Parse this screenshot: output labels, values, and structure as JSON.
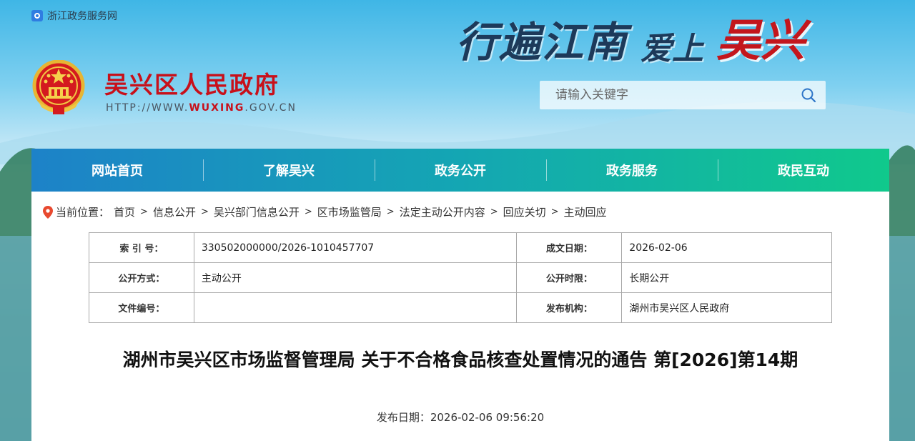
{
  "topbar": {
    "link": "浙江政务服务网"
  },
  "slogan": {
    "main": "行遍江南",
    "love": "爱上",
    "wuxing": "吴兴"
  },
  "site": {
    "title": "吴兴区人民政府",
    "url_prefix": "HTTP://WWW.",
    "url_highlight": "WUXING",
    "url_suffix": ".GOV.CN"
  },
  "search": {
    "placeholder": "请输入关键字"
  },
  "nav": [
    "网站首页",
    "了解吴兴",
    "政务公开",
    "政务服务",
    "政民互动"
  ],
  "breadcrumb": {
    "label": "当前位置：",
    "items": [
      "首页",
      "信息公开",
      "吴兴部门信息公开",
      "区市场监管局",
      "法定主动公开内容",
      "回应关切",
      "主动回应"
    ],
    "separator": ">"
  },
  "meta": {
    "rows": [
      {
        "k1": "索 引 号：",
        "v1": "330502000000/2026-1010457707",
        "k2": "成文日期：",
        "v2": "2026-02-06"
      },
      {
        "k1": "公开方式：",
        "v1": "主动公开",
        "k2": "公开时限：",
        "v2": "长期公开"
      },
      {
        "k1": "文件编号：",
        "v1": "",
        "k2": "发布机构：",
        "v2": "湖州市吴兴区人民政府"
      }
    ]
  },
  "article": {
    "title": "湖州市吴兴区市场监督管理局 关于不合格食品核查处置情况的通告 第[2026]第14期",
    "date_label": "发布日期：",
    "date_value": "2026-02-06 09:56:20"
  },
  "colors": {
    "brand_red": "#c8101a",
    "nav_start": "#1d82c8",
    "nav_end": "#10c98c"
  }
}
